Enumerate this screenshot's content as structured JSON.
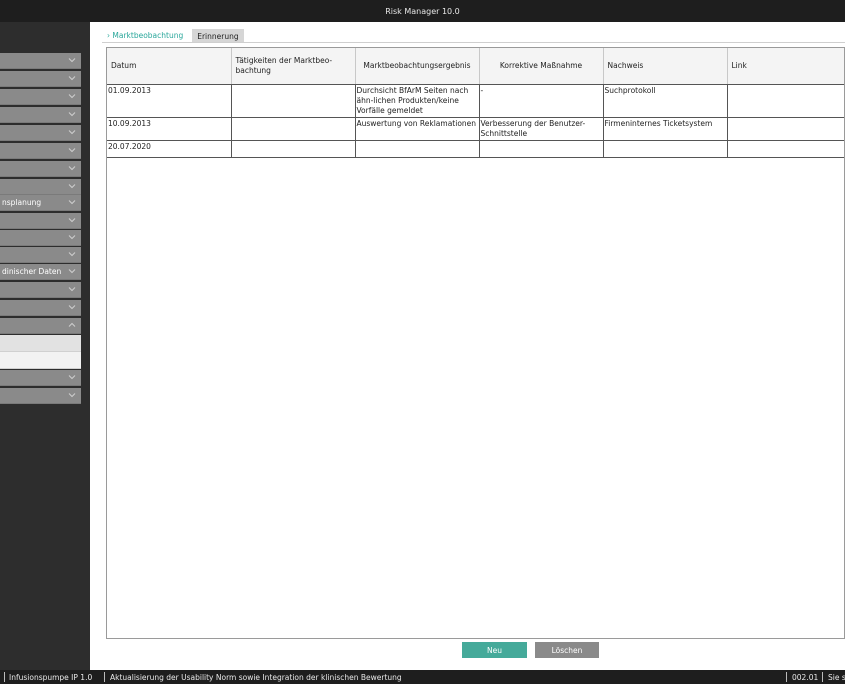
{
  "window": {
    "title": "Risk Manager   10.0"
  },
  "sidebar": {
    "items": [
      {
        "label": ""
      },
      {
        "label": ""
      },
      {
        "label": ""
      },
      {
        "label": ""
      },
      {
        "label": ""
      },
      {
        "label": ""
      },
      {
        "label": ""
      },
      {
        "label": ""
      },
      {
        "label": "nsplanung"
      },
      {
        "label": ""
      },
      {
        "label": ""
      },
      {
        "label": ""
      },
      {
        "label": "dinischer Daten"
      },
      {
        "label": ""
      },
      {
        "label": ""
      },
      {
        "label": ""
      },
      {
        "label": ""
      },
      {
        "label": ""
      }
    ]
  },
  "tabs": [
    {
      "label": "› Marktbeobachtung",
      "active": true
    },
    {
      "label": "Erinnerung",
      "active": false
    }
  ],
  "table": {
    "columns": [
      "Datum",
      "Tätigkeiten der Marktbeo-bachtung",
      "Marktbeobachtungsergebnis",
      "Korrektive Maßnahme",
      "Nachweis",
      "Link"
    ],
    "rows": [
      {
        "datum": "01.09.2013",
        "taetigkeiten": "",
        "ergebnis": "Durchsicht BfArM Seiten nach ähn-lichen Produkten/keine Vorfälle gemeldet",
        "massnahme": "-",
        "nachweis": "Suchprotokoll"
      },
      {
        "datum": "10.09.2013",
        "taetigkeiten": "",
        "ergebnis": "Auswertung von Reklamationen",
        "massnahme": "Verbesserung der Benutzer-Schnittstelle",
        "nachweis": "Firmeninternes Ticketsystem"
      },
      {
        "datum": "20.07.2020",
        "taetigkeiten": "",
        "ergebnis": "",
        "massnahme": "",
        "nachweis": ""
      }
    ]
  },
  "buttons": {
    "neu": "Neu",
    "loeschen": "Löschen"
  },
  "statusbar": {
    "project": "Infusionspumpe IP 1.0",
    "description": "Aktualisierung der Usability Norm sowie Integration der klinischen Bewertung",
    "version": "002.01",
    "truncated": "Sie s"
  },
  "colors": {
    "accent": "#2aa79b",
    "button_primary": "#45aa9a",
    "button_secondary": "#8a8a8a",
    "sidebar_item": "#8a8a8a",
    "chrome": "#1e1e1e"
  }
}
